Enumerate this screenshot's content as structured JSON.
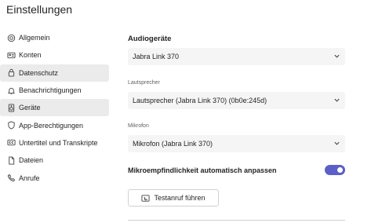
{
  "title": "Einstellungen",
  "nav": {
    "items": [
      {
        "label": "Allgemein",
        "icon": "gear-icon",
        "active": false
      },
      {
        "label": "Konten",
        "icon": "id-card-icon",
        "active": false
      },
      {
        "label": "Datenschutz",
        "icon": "lock-icon",
        "active": true
      },
      {
        "label": "Benachrichtigungen",
        "icon": "bell-icon",
        "active": false
      },
      {
        "label": "Geräte",
        "icon": "speaker-icon",
        "active": true
      },
      {
        "label": "App-Berechtigungen",
        "icon": "shield-icon",
        "active": false
      },
      {
        "label": "Untertitel und Transkripte",
        "icon": "closed-captions-icon",
        "active": false
      },
      {
        "label": "Dateien",
        "icon": "document-icon",
        "active": false
      },
      {
        "label": "Anrufe",
        "icon": "phone-icon",
        "active": false
      }
    ]
  },
  "devices": {
    "section_title": "Audiogeräte",
    "audio_device": {
      "value": "Jabra Link 370"
    },
    "speaker": {
      "label": "Lautsprecher",
      "value": "Lautsprecher (Jabra Link 370) (0b0e:245d)"
    },
    "microphone": {
      "label": "Mikrofon",
      "value": "Mikrofon (Jabra Link 370)"
    },
    "auto_adjust": {
      "label": "Mikroempfindlichkeit automatisch anpassen",
      "on": true
    },
    "test_call_label": "Testanruf führen"
  },
  "colors": {
    "accent": "#5b5fc7",
    "active_nav_bg": "#ebebeb",
    "select_bg": "#f5f5f5"
  }
}
